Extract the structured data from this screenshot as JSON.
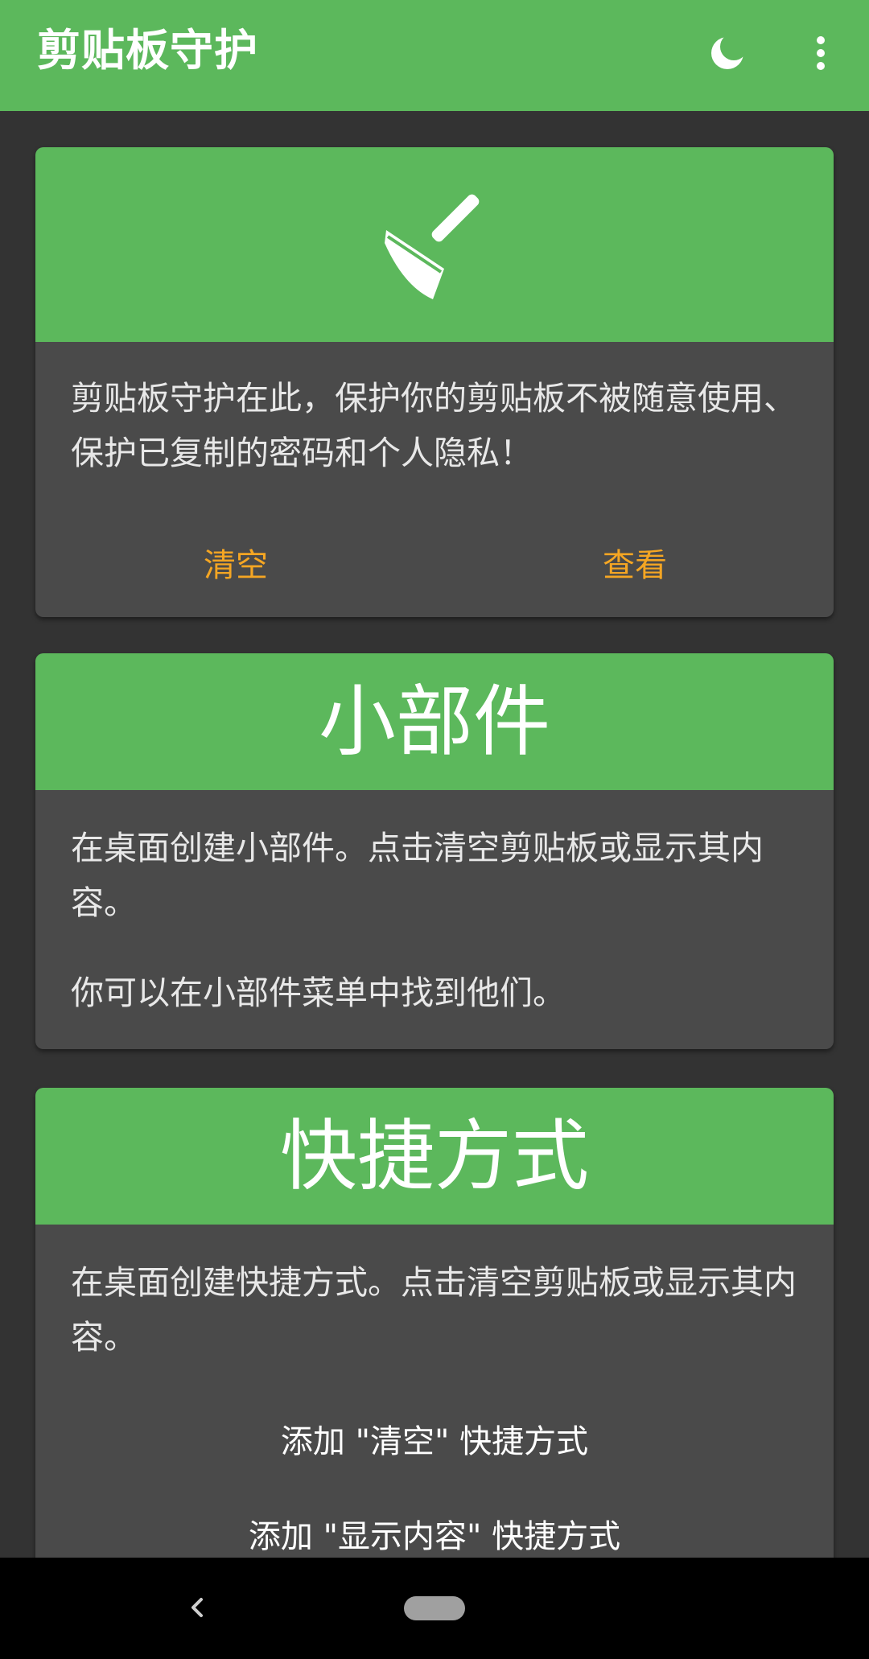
{
  "app_bar": {
    "title": "剪贴板守护",
    "actions": [
      "moon-icon",
      "more-vert-icon"
    ]
  },
  "guard_card": {
    "icon": "broom-icon",
    "description": "剪贴板守护在此，保护你的剪贴板不被随意使用、保护已复制的密码和个人隐私！",
    "clear_label": "清空",
    "view_label": "查看"
  },
  "widget_card": {
    "heading": "小部件",
    "description": "在桌面创建小部件。点击清空剪贴板或显示其内容。",
    "hint": "你可以在小部件菜单中找到他们。"
  },
  "shortcut_card": {
    "heading": "快捷方式",
    "description": "在桌面创建快捷方式。点击清空剪贴板或显示其内容。",
    "add_clear_label": "添加 \"清空\" 快捷方式",
    "add_show_label": "添加 \"显示内容\" 快捷方式"
  },
  "nav_bar": {
    "back": "back-icon",
    "home": "home-pill"
  },
  "colors": {
    "accent_green": "#5cb85c",
    "background": "#333333",
    "card": "#4a4a4a",
    "action_orange": "#f5a623"
  }
}
